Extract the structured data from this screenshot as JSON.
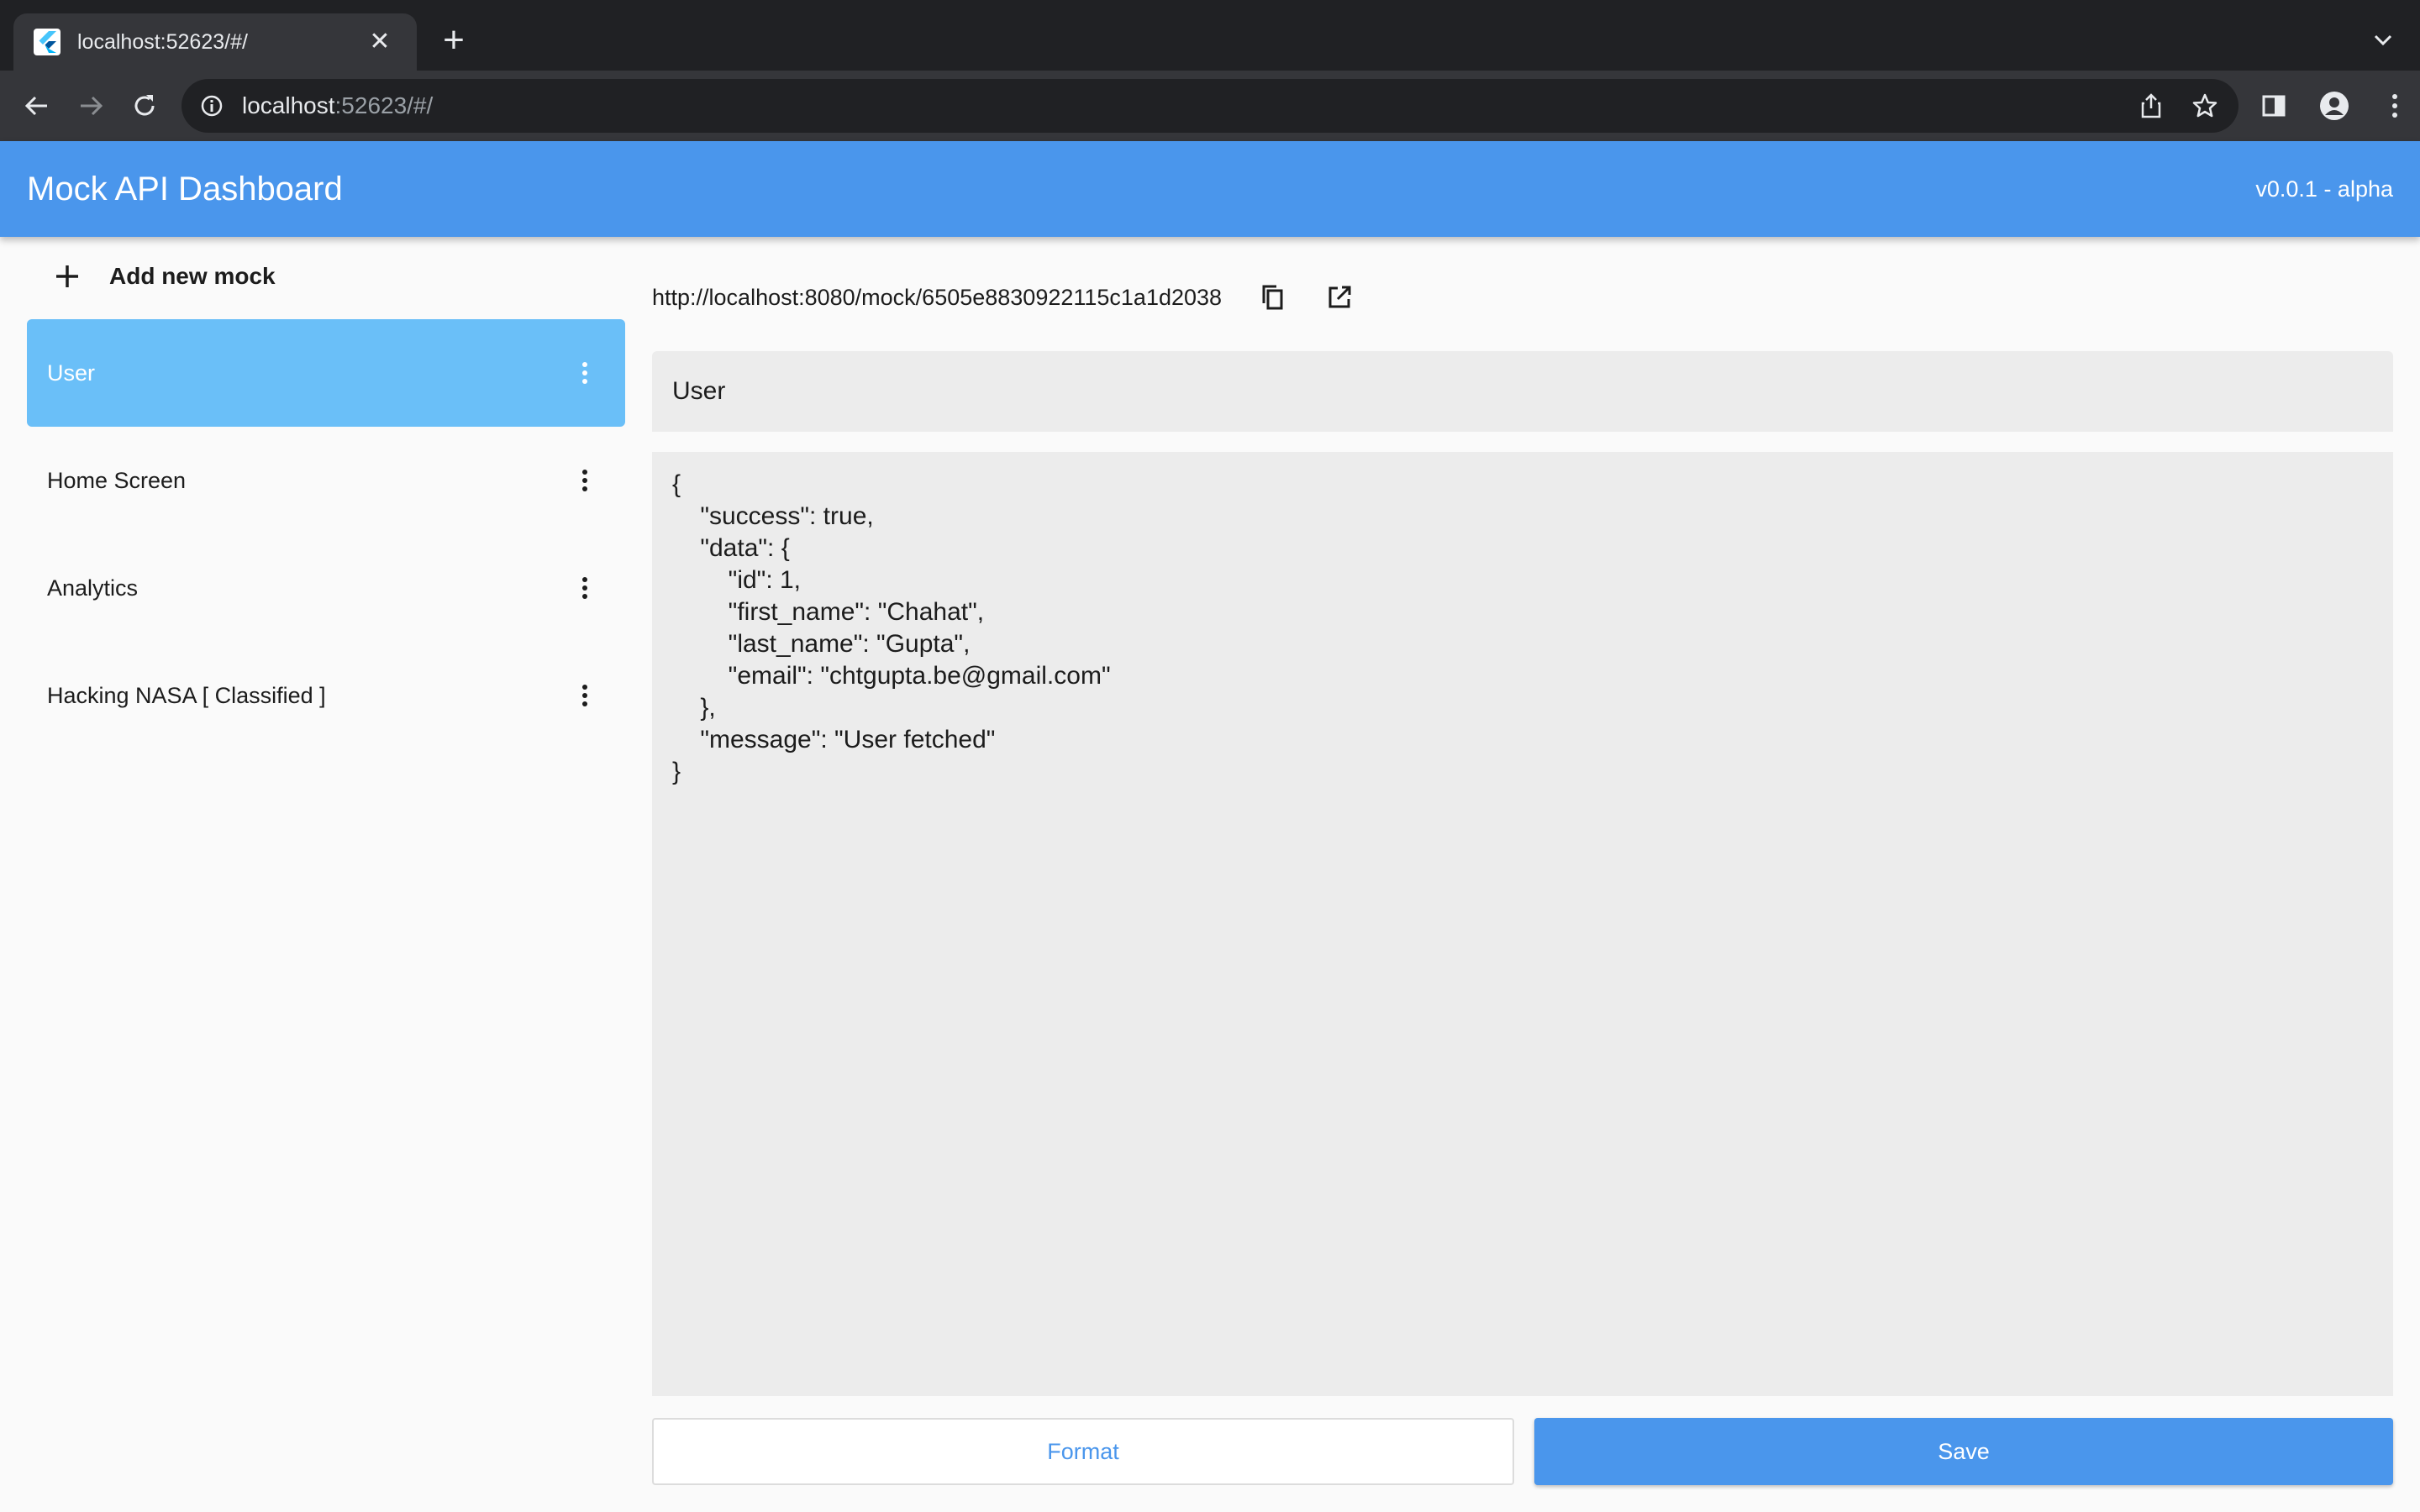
{
  "browser": {
    "tab_title": "localhost:52623/#/",
    "tab_close": "✕",
    "new_tab": "+",
    "address_host": "localhost",
    "address_path": ":52623/#/"
  },
  "app": {
    "title": "Mock API Dashboard",
    "version": "v0.0.1 - alpha"
  },
  "sidebar": {
    "add_label": "Add new mock",
    "items": [
      {
        "label": "User",
        "active": true
      },
      {
        "label": "Home Screen",
        "active": false
      },
      {
        "label": "Analytics",
        "active": false
      },
      {
        "label": "Hacking NASA [ Classified ]",
        "active": false
      }
    ]
  },
  "main": {
    "mock_url": "http://localhost:8080/mock/6505e8830922115c1a1d2038",
    "name_value": "User",
    "json_body": "{\n    \"success\": true,\n    \"data\": {\n        \"id\": 1,\n        \"first_name\": \"Chahat\",\n        \"last_name\": \"Gupta\",\n        \"email\": \"chtgupta.be@gmail.com\"\n    },\n    \"message\": \"User fetched\"\n}",
    "format_label": "Format",
    "save_label": "Save"
  },
  "colors": {
    "appbar": "#4a96ec",
    "active_item": "#6abff8",
    "field_bg": "#ececec"
  }
}
